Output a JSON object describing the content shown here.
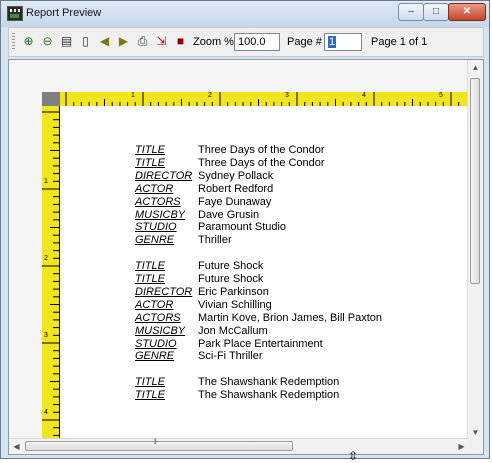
{
  "window": {
    "title": "Report Preview",
    "minimize": "–",
    "maximize": "□",
    "close": "✕"
  },
  "toolbar": {
    "buttons": [
      {
        "name": "zoom-in-icon",
        "glyph": "⊕",
        "color": "#2a6a2a"
      },
      {
        "name": "zoom-out-icon",
        "glyph": "⊖",
        "color": "#2a6a2a"
      },
      {
        "name": "page-width-icon",
        "glyph": "▤",
        "color": "#333333"
      },
      {
        "name": "whole-page-icon",
        "glyph": "▯",
        "color": "#333333"
      },
      {
        "name": "previous-page-icon",
        "glyph": "◀",
        "color": "#7a7a10"
      },
      {
        "name": "next-page-icon",
        "glyph": "▶",
        "color": "#7a7a10"
      },
      {
        "name": "print-icon",
        "glyph": "⎙",
        "color": "#333333"
      },
      {
        "name": "export-icon",
        "glyph": "⇲",
        "color": "#b01010"
      },
      {
        "name": "exit-icon",
        "glyph": "■",
        "color": "#8b0000"
      }
    ],
    "zoom_label": "Zoom %",
    "zoom_value": "100.0",
    "page_label": "Page #",
    "page_value": "1",
    "page_info": "Page 1 of 1"
  },
  "ruler": {
    "h_numbers": [
      "1",
      "2",
      "3",
      "4",
      "5"
    ],
    "v_numbers": [
      "1",
      "2",
      "3",
      "4"
    ]
  },
  "report": {
    "records": [
      [
        {
          "key": "TITLE",
          "value": "Three Days of the Condor"
        },
        {
          "key": "TITLE",
          "value": "Three Days of the Condor"
        },
        {
          "key": "DIRECTOR",
          "value": "Sydney Pollack"
        },
        {
          "key": "ACTOR",
          "value": "Robert Redford"
        },
        {
          "key": "ACTORS",
          "value": "Faye Dunaway"
        },
        {
          "key": "MUSICBY",
          "value": "Dave Grusin"
        },
        {
          "key": "STUDIO",
          "value": "Paramount Studio"
        },
        {
          "key": "GENRE",
          "value": "Thriller"
        }
      ],
      [
        {
          "key": "TITLE",
          "value": "Future Shock"
        },
        {
          "key": "TITLE",
          "value": "Future Shock"
        },
        {
          "key": "DIRECTOR",
          "value": "Eric Parkinson"
        },
        {
          "key": "ACTOR",
          "value": "Vivian Schilling"
        },
        {
          "key": "ACTORS",
          "value": "Martin Kove, Brion James, Bill Paxton"
        },
        {
          "key": "MUSICBY",
          "value": "Jon McCallum"
        },
        {
          "key": "STUDIO",
          "value": "Park Place Entertainment"
        },
        {
          "key": "GENRE",
          "value": "Sci-Fi Thriller"
        }
      ],
      [
        {
          "key": "TITLE",
          "value": "The Shawshank Redemption"
        },
        {
          "key": "TITLE",
          "value": "The Shawshank Redemption"
        }
      ]
    ]
  },
  "scrollbars": {
    "up": "▲",
    "down": "▼",
    "left": "◀",
    "right": "▶"
  }
}
